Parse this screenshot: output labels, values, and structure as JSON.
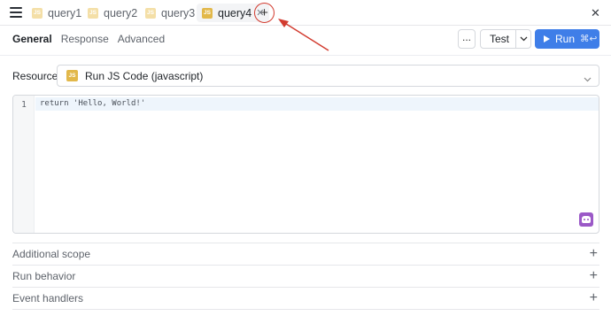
{
  "tabs": [
    {
      "label": "query1",
      "icon": "js-icon",
      "active": false
    },
    {
      "label": "query2",
      "icon": "js-icon",
      "active": false
    },
    {
      "label": "query3",
      "icon": "js-icon",
      "active": false
    },
    {
      "label": "query4",
      "icon": "js-icon",
      "active": true
    }
  ],
  "js_badge": "JS",
  "add_tab_label": "+",
  "close_glyph": "✕",
  "subtabs": {
    "general": "General",
    "response": "Response",
    "advanced": "Advanced"
  },
  "toolbar": {
    "more_label": "...",
    "test_label": "Test",
    "run_label": "Run",
    "run_shortcut": "⌘↩"
  },
  "resource": {
    "label": "Resource",
    "value": "Run JS Code (javascript)"
  },
  "editor": {
    "line_number": "1",
    "code": "return 'Hello, World!'"
  },
  "sections": {
    "scope": "Additional scope",
    "behavior": "Run behavior",
    "events": "Event handlers"
  },
  "colors": {
    "accent": "#3f7ee8",
    "js_badge": "#e2b84a",
    "annotation": "#d23b2f",
    "ai_button": "#9b59c7"
  }
}
